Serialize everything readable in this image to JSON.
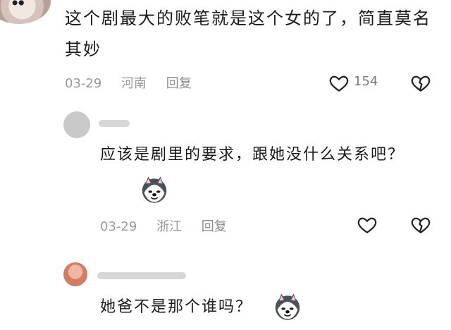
{
  "comments": [
    {
      "text": "这个剧最大的败笔就是这个女的了，简直莫名其妙",
      "date": "03-29",
      "location": "河南",
      "reply_label": "回复",
      "like_count": "154",
      "icons": [
        "heart-icon",
        "broken-heart-icon"
      ]
    },
    {
      "text": "应该是剧里的要求，跟她没什么关系吧？",
      "date": "03-29",
      "location": "浙江",
      "reply_label": "回复",
      "emoji": "husky-emoji",
      "icons": [
        "heart-icon",
        "broken-heart-icon"
      ]
    },
    {
      "text": "她爸不是那个谁吗？",
      "emoji": "husky-emoji"
    }
  ]
}
